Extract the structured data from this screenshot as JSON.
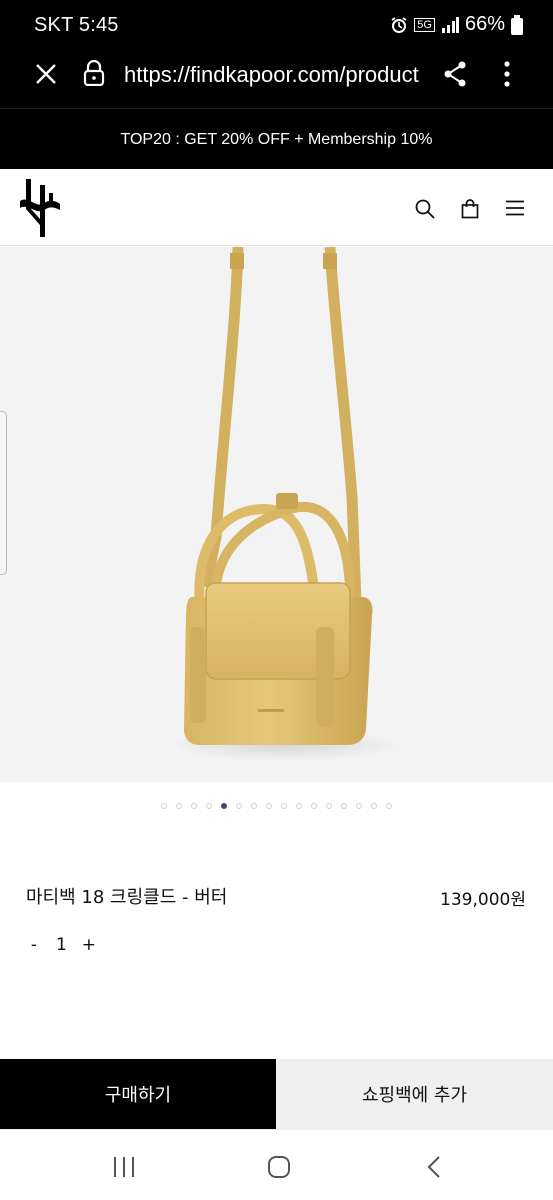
{
  "status": {
    "carrier_time": "SKT 5:45",
    "network": "5G",
    "battery": "66%"
  },
  "browser": {
    "url": "https://findkapoor.com/product"
  },
  "promo": {
    "text": "TOP20 : GET 20% OFF + Membership 10%"
  },
  "header": {
    "icons": [
      "logo-icon",
      "search-icon",
      "bag-icon",
      "menu-icon"
    ]
  },
  "gallery": {
    "total": 16,
    "active_index": 5
  },
  "product": {
    "name": "마티백 18 크링클드 - 버터",
    "price": "139,000원",
    "quantity": "1",
    "minus": "-",
    "plus": "+"
  },
  "actions": {
    "buy_label": "구매하기",
    "cart_label": "쇼핑백에 추가"
  },
  "colors": {
    "bag": "#e2c374",
    "strap": "#d8b865",
    "hero_bg": "#f3f3f3",
    "active_dot": "#4a3f73"
  }
}
